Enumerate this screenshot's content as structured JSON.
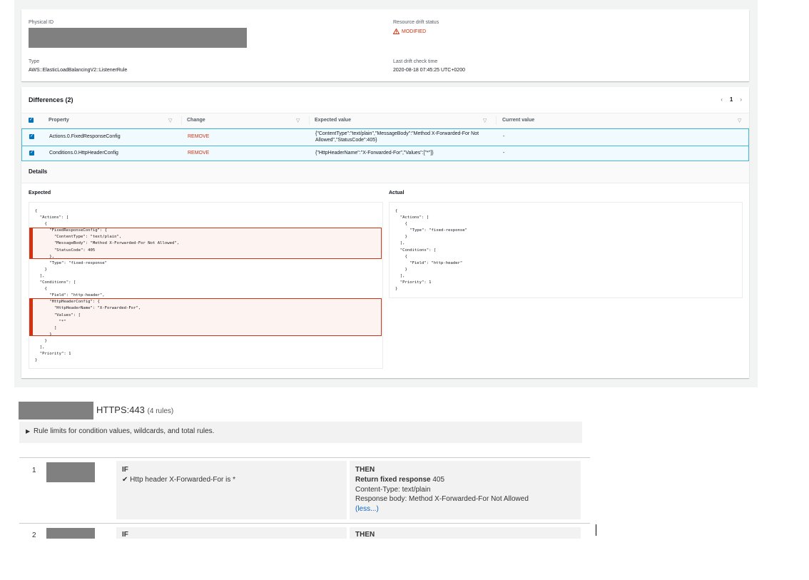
{
  "resource": {
    "physical_id_label": "Physical ID",
    "type_label": "Type",
    "type_value": "AWS::ElasticLoadBalancingV2::ListenerRule",
    "drift_status_label": "Resource drift status",
    "drift_status_value": "MODIFIED",
    "last_check_label": "Last drift check time",
    "last_check_value": "2020-08-18 07:45:25 UTC+0200"
  },
  "differences": {
    "title": "Differences",
    "count": "(2)",
    "page": "1",
    "columns": [
      "Property",
      "Change",
      "Expected value",
      "Current value"
    ],
    "rows": [
      {
        "property": "Actions.0.FixedResponseConfig",
        "change": "REMOVE",
        "expected": "{\"ContentType\":\"text/plain\",\"MessageBody\":\"Method X-Forwarded-For Not Allowed\",\"StatusCode\":405}",
        "current": "-"
      },
      {
        "property": "Conditions.0.HttpHeaderConfig",
        "change": "REMOVE",
        "expected": "{\"HttpHeaderName\":\"X-Forwarded-For\",\"Values\":[\"*\"]}",
        "current": "-"
      }
    ]
  },
  "details": {
    "title": "Details",
    "expected_label": "Expected",
    "actual_label": "Actual",
    "expected_json": "{\n  \"Actions\": [\n    {\n      \"FixedResponseConfig\": {\n        \"ContentType\": \"text/plain\",\n        \"MessageBody\": \"Method X-Forwarded-For Not Allowed\",\n        \"StatusCode\": 405\n      },\n      \"Type\": \"fixed-response\"\n    }\n  ],\n  \"Conditions\": [\n    {\n      \"Field\": \"http-header\",\n      \"HttpHeaderConfig\": {\n        \"HttpHeaderName\": \"X-Forwarded-For\",\n        \"Values\": [\n          \"*\"\n        ]\n      }\n    }\n  ],\n  \"Priority\": 1\n}",
    "actual_json": "{\n  \"Actions\": [\n    {\n      \"Type\": \"fixed-response\"\n    }\n  ],\n  \"Conditions\": [\n    {\n      \"Field\": \"http-header\"\n    }\n  ],\n  \"Priority\": 1\n}"
  },
  "listener": {
    "protocol": "HTTPS:443",
    "rule_count": "(4 rules)",
    "limits_text": "Rule limits for condition values, wildcards, and total rules.",
    "rules": [
      {
        "number": "1",
        "if_label": "IF",
        "condition": "Http header X-Forwarded-For is *",
        "then_label": "THEN",
        "action_title": "Return fixed response",
        "status_code": "405",
        "content_type": "Content-Type: text/plain",
        "response_body": "Response body: Method X-Forwarded-For Not Allowed",
        "less_link": "(less...)"
      },
      {
        "number": "2",
        "if_label": "IF",
        "then_label": "THEN"
      }
    ]
  },
  "colors": {
    "accent": "#0073bb",
    "danger": "#d13212",
    "row_border": "#44b9d6"
  }
}
